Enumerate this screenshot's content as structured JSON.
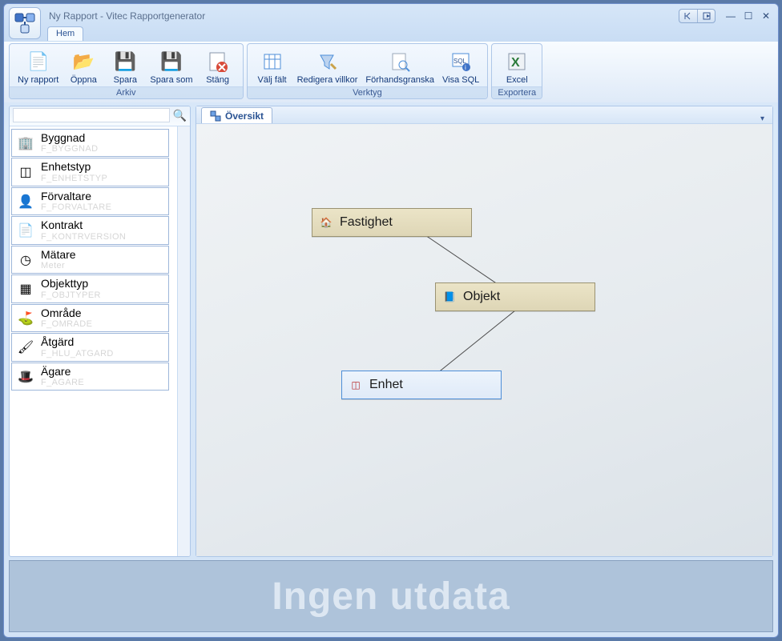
{
  "window": {
    "title": "Ny Rapport - Vitec Rapportgenerator",
    "tab_hem": "Hem"
  },
  "ribbon": {
    "arkiv": {
      "label": "Arkiv",
      "ny_rapport": "Ny rapport",
      "oppna": "Öppna",
      "spara": "Spara",
      "spara_som": "Spara som",
      "stang": "Stäng"
    },
    "verktyg": {
      "label": "Verktyg",
      "valj_falt": "Välj fält",
      "redigera_villkor": "Redigera villkor",
      "forhandsgranska": "Förhandsgranska",
      "visa_sql": "Visa SQL"
    },
    "exportera": {
      "label": "Exportera",
      "excel": "Excel"
    }
  },
  "sidebar": {
    "search_placeholder": "",
    "items": [
      {
        "name": "Byggnad",
        "sub": "F_BYGGNAD",
        "icon": "office-building-icon",
        "glyph": "🏢"
      },
      {
        "name": "Enhetstyp",
        "sub": "F_ENHETSTYP",
        "icon": "enhet-icon",
        "glyph": "◫"
      },
      {
        "name": "Förvaltare",
        "sub": "F_FORVALTARE",
        "icon": "person-icon",
        "glyph": "👤"
      },
      {
        "name": "Kontrakt",
        "sub": "F_KONTRVERSION",
        "icon": "document-icon",
        "glyph": "📄"
      },
      {
        "name": "Mätare",
        "sub": "Meter",
        "icon": "meter-icon",
        "glyph": "◷"
      },
      {
        "name": "Objekttyp",
        "sub": "F_OBJTYPER",
        "icon": "layout-icon",
        "glyph": "▦"
      },
      {
        "name": "Område",
        "sub": "F_OMRADE",
        "icon": "area-icon",
        "glyph": "⛳"
      },
      {
        "name": "Åtgärd",
        "sub": "F_HLU_ATGARD",
        "icon": "brush-icon",
        "glyph": "🖌"
      },
      {
        "name": "Ägare",
        "sub": "F_AGARE",
        "icon": "hat-icon",
        "glyph": "🎩"
      }
    ]
  },
  "canvas": {
    "tab_label": "Översikt",
    "nodes": {
      "fastighet": {
        "label": "Fastighet",
        "glyph": "🏠"
      },
      "objekt": {
        "label": "Objekt",
        "glyph": "📘"
      },
      "enhet": {
        "label": "Enhet",
        "glyph": "◫"
      }
    }
  },
  "output": {
    "text": "Ingen utdata"
  }
}
